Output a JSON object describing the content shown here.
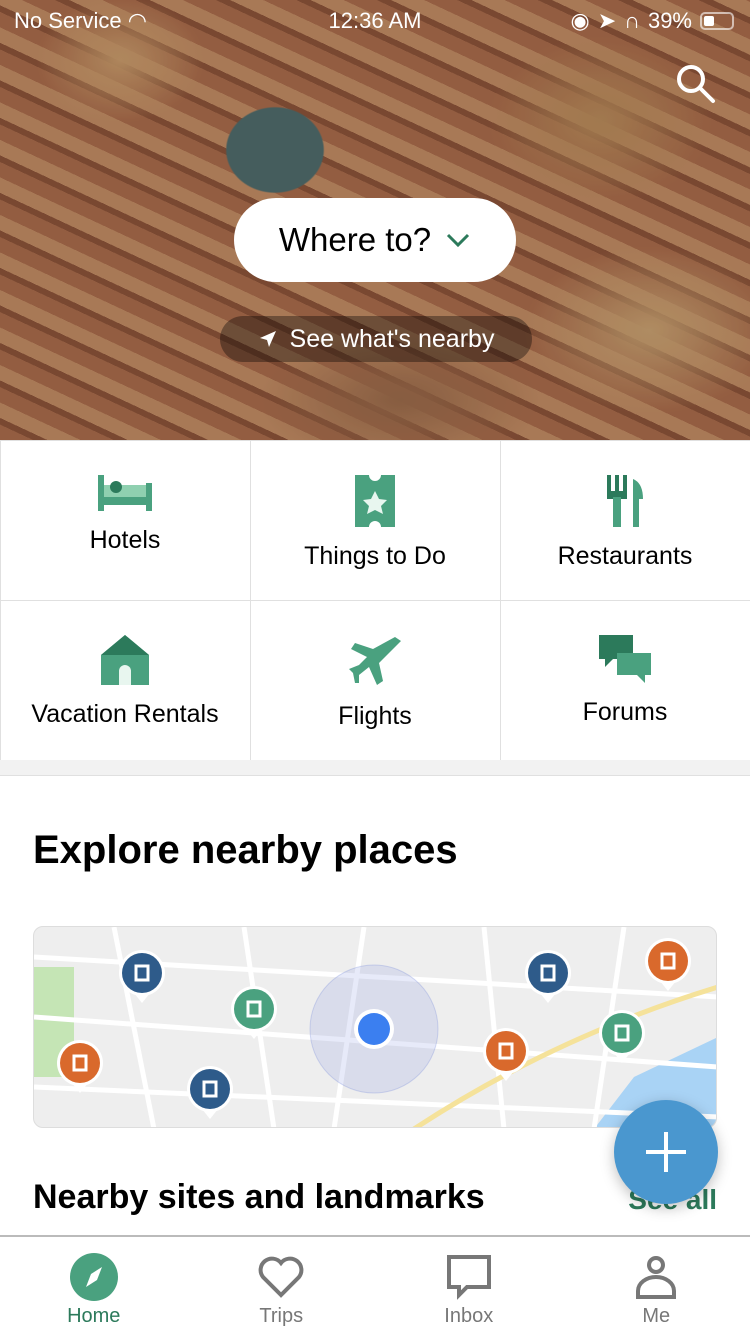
{
  "status_bar": {
    "carrier": "No Service",
    "time": "12:36 AM",
    "battery": "39%"
  },
  "hero": {
    "where_to": "Where to?",
    "see_nearby": "See what's nearby"
  },
  "categories": [
    {
      "label": "Hotels",
      "icon": "bed-icon"
    },
    {
      "label": "Things to Do",
      "icon": "ticket-icon"
    },
    {
      "label": "Restaurants",
      "icon": "fork-knife-icon"
    },
    {
      "label": "Vacation Rentals",
      "icon": "house-icon"
    },
    {
      "label": "Flights",
      "icon": "plane-icon"
    },
    {
      "label": "Forums",
      "icon": "chat-bubbles-icon"
    }
  ],
  "explore": {
    "title": "Explore nearby places"
  },
  "sites": {
    "title": "Nearby sites and landmarks",
    "see_all": "See all"
  },
  "tabs": [
    {
      "label": "Home",
      "active": true
    },
    {
      "label": "Trips"
    },
    {
      "label": "Inbox"
    },
    {
      "label": "Me"
    }
  ],
  "colors": {
    "accent": "#2c7a5b",
    "icon_green": "#4aa17f",
    "fab": "#4a97cf",
    "hotel_pin": "#4aa17f",
    "attraction_pin": "#2e5b8a",
    "restaurant_pin": "#d9692c",
    "location_dot": "#3b7ff0"
  }
}
